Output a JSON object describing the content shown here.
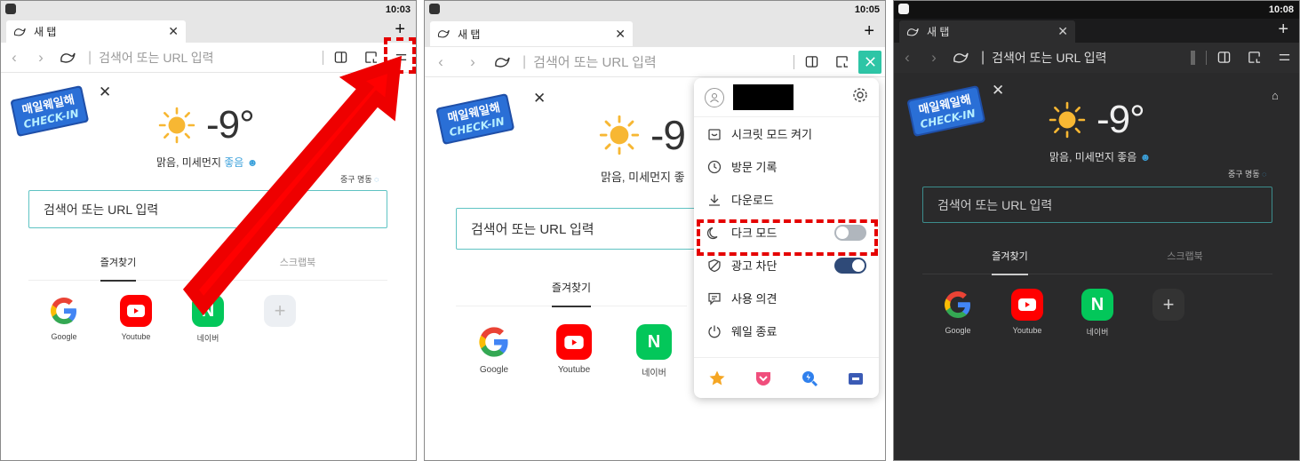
{
  "colors": {
    "accent": "#5fc3c3",
    "highlight_red": "#e50000",
    "dark_bg": "#2a2a2b"
  },
  "panel1": {
    "time": "10:03",
    "tab_title": "새 탭",
    "url_placeholder": "검색어 또는 URL 입력",
    "temperature": "-9°",
    "air_quality_text": "맑음, 미세먼지 ",
    "air_quality_level": "좋음",
    "location": "중구 명동",
    "search_placeholder": "검색어 또는 URL 입력",
    "tabs": [
      "즐겨찾기",
      "스크랩북"
    ],
    "shortcuts": [
      "Google",
      "Youtube",
      "네이버"
    ]
  },
  "panel2": {
    "time": "10:05",
    "tab_title": "새 탭",
    "url_placeholder": "검색어 또는 URL 입력",
    "temperature": "-9",
    "air_quality_text": "맑음, 미세먼지 좋",
    "search_placeholder": "검색어 또는 URL 입력",
    "tabs": [
      "즐겨찾기"
    ],
    "shortcuts": [
      "Google",
      "Youtube",
      "네이버"
    ],
    "menu": {
      "items": [
        {
          "label": "시크릿 모드 켜기",
          "icon": "secret-mode-icon"
        },
        {
          "label": "방문 기록",
          "icon": "history-clock-icon"
        },
        {
          "label": "다운로드",
          "icon": "download-icon"
        },
        {
          "label": "다크 모드",
          "icon": "moon-icon",
          "toggle": "off"
        },
        {
          "label": "광고 차단",
          "icon": "shield-icon",
          "toggle": "on"
        },
        {
          "label": "사용 의견",
          "icon": "feedback-icon"
        },
        {
          "label": "웨일 종료",
          "icon": "power-icon"
        }
      ],
      "footer_icons": [
        "star-icon",
        "pocket-icon",
        "search-magnifier-icon",
        "inbox-icon"
      ]
    }
  },
  "panel3": {
    "time": "10:08",
    "tab_title": "새 탭",
    "url_placeholder": "검색어 또는 URL 입력",
    "temperature": "-9°",
    "air_quality_text": "맑음, 미세먼지 좋음",
    "location": "중구 명동",
    "search_placeholder": "검색어 또는 URL 입력",
    "tabs": [
      "즐겨찾기",
      "스크랩북"
    ],
    "shortcuts": [
      "Google",
      "Youtube",
      "네이버"
    ]
  }
}
